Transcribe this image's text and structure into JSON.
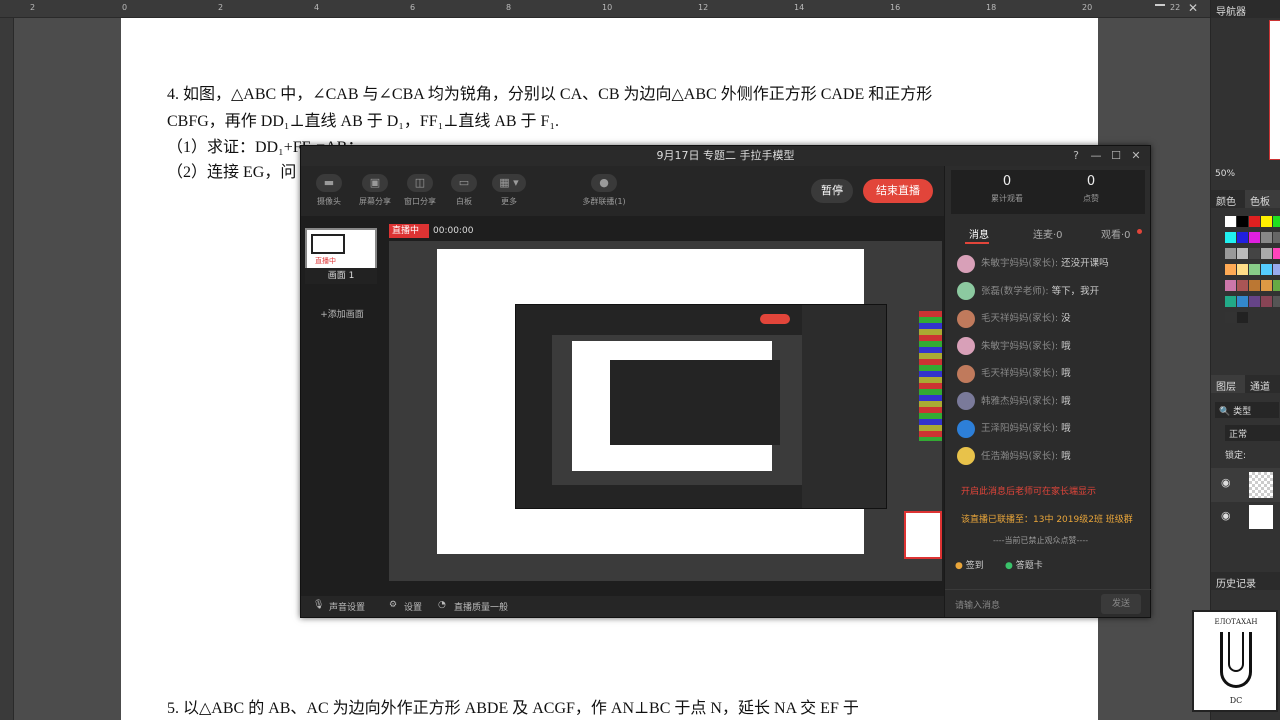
{
  "document": {
    "line1": "4.  如图，△ABC 中，∠CAB 与∠CBA 均为锐角，分别以 CA、CB 为边向△ABC 外侧作正方形 CADE 和正方形",
    "line2": "CBFG，再作 DD₁⊥直线 AB 于 D₁，FF₁⊥直线 AB 于 F₁.",
    "line3": "（1）求证：DD₁+FF₁=AB；",
    "line4": "（2）连接 EG，问",
    "line5": "5.  以△ABC 的 AB、AC 为边向外作正方形 ABDE 及 ACGF，作 AN⊥BC 于点 N，延长 NA 交 EF 于"
  },
  "photoshop": {
    "panel_navigator": "导航器",
    "zoom": "50%",
    "tab_color": "颜色",
    "tab_swatches": "色板",
    "tab_layers": "图层",
    "tab_channels": "通道",
    "layer_kind": "类型",
    "blend_mode": "正常",
    "lock_label": "锁定:",
    "history": "历史记录"
  },
  "live_window": {
    "title": "9月17日 专题二 手拉手模型",
    "toolbar": {
      "camera": "摄像头",
      "screen_share": "屏幕分享",
      "window_share": "窗口分享",
      "whiteboard": "白板",
      "more": "更多",
      "multi_connect": "多群联播(1)"
    },
    "pause": "暂停",
    "end_live": "结束直播",
    "scene_badge": "直播中",
    "scene_name": "画面 1",
    "add_scene": "+添加画面",
    "live_status": "直播中",
    "live_time": "00:00:00",
    "bottom": {
      "audio": "声音设置",
      "settings": "设置",
      "quality": "直播质量一般"
    },
    "stats": {
      "viewers_count": "0",
      "viewers_label": "累计观看",
      "likes_count": "0",
      "likes_label": "点赞"
    },
    "tabs": {
      "messages": "消息",
      "connect": "连麦·0",
      "watch": "观看·0"
    },
    "messages": [
      {
        "sender": "朱敏宇妈妈(家长): ",
        "text": "还没开课吗",
        "color": "#d8a0b8"
      },
      {
        "sender": "张磊(数学老师): ",
        "text": "等下，我开",
        "color": "#8cc9a0"
      },
      {
        "sender": "毛天祥妈妈(家长): ",
        "text": "没",
        "color": "#c07a5c"
      },
      {
        "sender": "朱敏宇妈妈(家长): ",
        "text": "哦",
        "color": "#d8a0b8"
      },
      {
        "sender": "毛天祥妈妈(家长): ",
        "text": "哦",
        "color": "#c07a5c"
      },
      {
        "sender": "韩雅杰妈妈(家长): ",
        "text": "哦",
        "color": "#7a7a9a"
      },
      {
        "sender": "王泽阳妈妈(家长): ",
        "text": "哦",
        "color": "#2d7fd8"
      },
      {
        "sender": "任浩瀚妈妈(家长): ",
        "text": "哦",
        "color": "#e8c24a"
      }
    ],
    "notice_red": "开启此消息后老师可在家长端显示",
    "notice_orange": "该直播已联播至：13中 2019级2班 班级群",
    "notice_gray": "----当前已禁止观众点赞----",
    "sign_in": "签到",
    "answer_card": "答题卡",
    "input_placeholder": "请输入消息",
    "send": "发送"
  },
  "logo": {
    "text_top": "ЕЛОТАХАН",
    "text_bottom": "DC"
  }
}
